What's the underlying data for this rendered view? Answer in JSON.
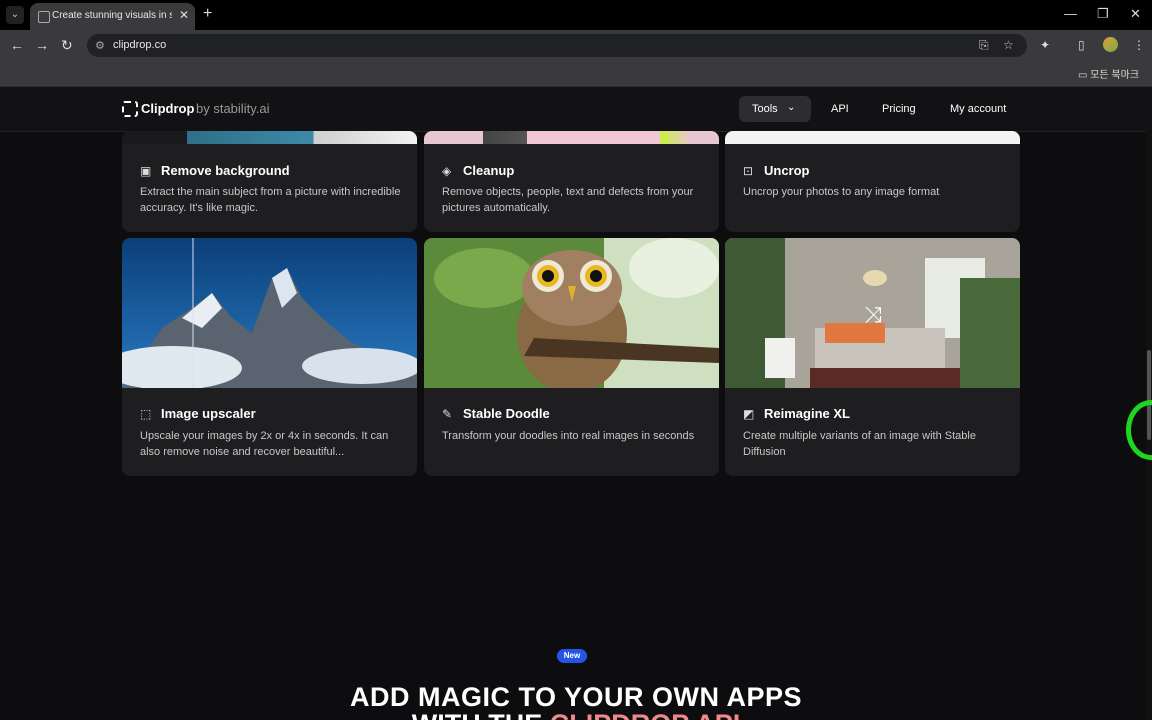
{
  "browser": {
    "tab_title": "Create stunning visuals in seconds",
    "url": "clipdrop.co",
    "bookmarks_label": "모든 북마크",
    "icons": [
      "tab-list-icon",
      "close-icon",
      "plus-icon",
      "minimize-icon",
      "restore-icon",
      "window-close-icon",
      "back-icon",
      "forward-icon",
      "reload-icon",
      "site-info-icon",
      "translate-icon",
      "star-icon",
      "extensions-icon",
      "side-panel-icon",
      "menu-icon",
      "folder-icon"
    ]
  },
  "site": {
    "brand": "Clipdrop",
    "brand_by": "by stability.ai",
    "nav": {
      "tools": "Tools",
      "api": "API",
      "pricing": "Pricing",
      "account": "My account"
    }
  },
  "cards_row1": [
    {
      "title": "Remove background",
      "desc": "Extract the main subject from a picture with incredible accuracy. It's like magic.",
      "icon": "remove-background-icon"
    },
    {
      "title": "Cleanup",
      "desc": "Remove objects, people, text and defects from your pictures automatically.",
      "icon": "eraser-icon"
    },
    {
      "title": "Uncrop",
      "desc": "Uncrop your photos to any image format",
      "icon": "uncrop-icon"
    }
  ],
  "cards_row2": [
    {
      "title": "Image upscaler",
      "desc": "Upscale your images by 2x or 4x in seconds. It can also remove noise and recover beautiful...",
      "icon": "upscale-icon"
    },
    {
      "title": "Stable Doodle",
      "desc": "Transform your doodles into real images in seconds",
      "icon": "magic-wand-icon"
    },
    {
      "title": "Reimagine XL",
      "desc": "Create multiple variants of an image with Stable Diffusion",
      "icon": "image-icon"
    }
  ],
  "promo": {
    "badge": "New",
    "headline": "ADD MAGIC TO YOUR OWN APPS",
    "headline2_prefix": "WITH THE ",
    "headline2_accent": "CLIPDROP API"
  }
}
